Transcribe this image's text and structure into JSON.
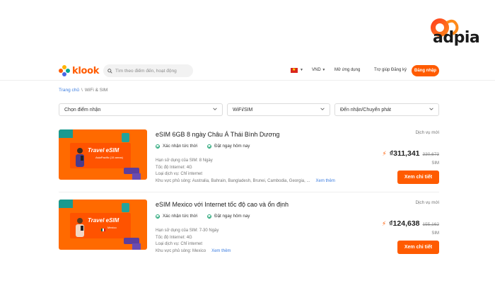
{
  "watermark": {
    "text": "adpia",
    "colors": [
      "#ff3a1f",
      "#ff8a1a"
    ]
  },
  "header": {
    "logo_text": "klook",
    "search_placeholder": "Tìm theo điểm đến, hoạt động",
    "currency": "VND",
    "app_label": "Mở ứng dụng",
    "help_label": "Trợ giúp",
    "register_label": "Đăng ký",
    "login_label": "Đăng nhập"
  },
  "breadcrumb": {
    "home": "Trang chủ",
    "separator": "\\",
    "current": "WiFi & SIM"
  },
  "filters": [
    {
      "label": "Chọn điểm nhận"
    },
    {
      "label": "WiFi/SIM"
    },
    {
      "label": "Đến nhận/Chuyển phát"
    }
  ],
  "products": [
    {
      "title": "eSIM 6GB 8 ngày Châu Á Thái Bình Dương",
      "badge_confirm": "Xác nhận tức thời",
      "badge_book": "Đặt ngay hôm nay",
      "specs": {
        "validity": "Hạn sử dụng của SIM: 8 Ngày",
        "speed": "Tốc độ Internet: 4G",
        "service": "Loại dịch vụ: Chỉ internet",
        "coverage": "Khu vực phủ sóng: Australia, Bahrain, Bangladesh, Brunei, Cambodia, Georgia, ...",
        "more": "Xem thêm"
      },
      "service_label": "Dịch vụ mới",
      "price": "₫311,341",
      "old_price": "330,673",
      "unit": "SIM",
      "button": "Xem chi tiết",
      "thumb_title": "Travel eSIM",
      "thumb_sub": "AsiaPacific (15 areas)"
    },
    {
      "title": "eSIM Mexico với Internet tốc độ cao và ổn định",
      "badge_confirm": "Xác nhận tức thời",
      "badge_book": "Đặt ngay hôm nay",
      "specs": {
        "validity": "Hạn sử dụng của SIM: 7-30 Ngày",
        "speed": "Tốc độ Internet: 4G",
        "service": "Loại dịch vụ: Chỉ internet",
        "coverage": "Khu vực phủ sóng: Mexico",
        "more": "Xem thêm"
      },
      "service_label": "Dịch vụ mới",
      "price": "₫124,638",
      "old_price": "155,162",
      "unit": "SIM",
      "button": "Xem chi tiết",
      "thumb_title": "Travel eSIM",
      "thumb_sub": "Mexico"
    }
  ],
  "colors": {
    "accent": "#ff5b00",
    "link": "#3c7de0",
    "check": "#2aa87a"
  }
}
